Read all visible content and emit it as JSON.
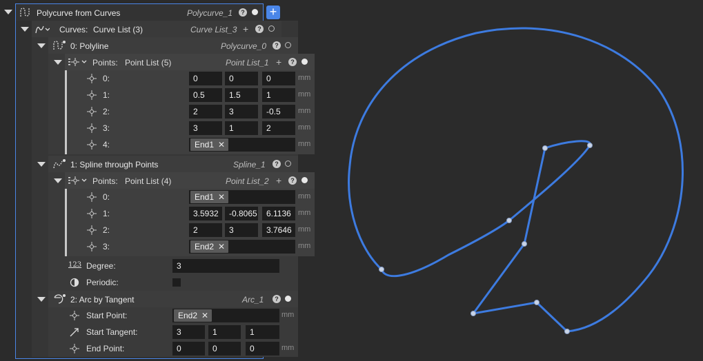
{
  "root": {
    "title": "Polycurve from Curves",
    "subtitle": "Polycurve_1"
  },
  "curves": {
    "label": "Curves:",
    "value": "Curve List (3)",
    "subtitle": "Curve List_3"
  },
  "polyline": {
    "title": "0:  Polyline",
    "subtitle": "Polycurve_0",
    "points": {
      "label": "Points:",
      "value": "Point List (5)",
      "subtitle": "Point List_1"
    },
    "rows": [
      {
        "label": "0:",
        "values": [
          "0",
          "0",
          "0"
        ],
        "unit": "mm"
      },
      {
        "label": "1:",
        "values": [
          "0.5",
          "1.5",
          "1"
        ],
        "unit": "mm"
      },
      {
        "label": "2:",
        "values": [
          "2",
          "3",
          "-0.5"
        ],
        "unit": "mm"
      },
      {
        "label": "3:",
        "values": [
          "3",
          "1",
          "2"
        ],
        "unit": "mm"
      },
      {
        "label": "4:",
        "ref": "End1",
        "unit": "mm"
      }
    ]
  },
  "spline": {
    "title": "1:  Spline through Points",
    "subtitle": "Spline_1",
    "points": {
      "label": "Points:",
      "value": "Point List (4)",
      "subtitle": "Point List_2"
    },
    "rows": [
      {
        "label": "0:",
        "ref": "End1",
        "unit": "mm"
      },
      {
        "label": "1:",
        "values": [
          "3.5932",
          "-0.8065",
          "6.1136"
        ],
        "unit": "mm"
      },
      {
        "label": "2:",
        "values": [
          "2",
          "3",
          "3.7646"
        ],
        "unit": "mm"
      },
      {
        "label": "3:",
        "ref": "End2",
        "unit": "mm"
      }
    ],
    "degree": {
      "label": "Degree:",
      "value": "3"
    },
    "periodic": {
      "label": "Periodic:"
    }
  },
  "arc": {
    "title": "2:  Arc by Tangent",
    "subtitle": "Arc_1",
    "start_point": {
      "label": "Start Point:",
      "ref": "End2",
      "unit": "mm"
    },
    "start_tangent": {
      "label": "Start Tangent:",
      "values": [
        "3",
        "1",
        "1"
      ]
    },
    "end_point": {
      "label": "End Point:",
      "values": [
        "0",
        "0",
        "0"
      ],
      "unit": "mm"
    }
  },
  "icons": {
    "add": "plus-icon",
    "help": "help-icon",
    "visible": "visibility-dot-icon",
    "hidden": "visibility-ring-icon",
    "remove": "remove-x-icon",
    "point": "point-icon"
  },
  "colors": {
    "accent": "#4a86e8",
    "curve": "#3d7be0",
    "panel": "#3a3a3a",
    "field": "#1d1d1d",
    "background": "#2b2b2b"
  }
}
